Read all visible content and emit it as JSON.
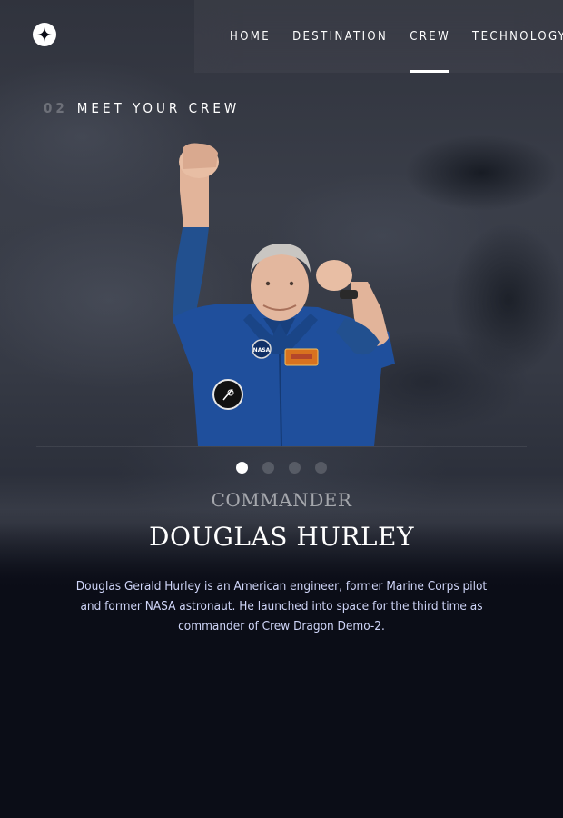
{
  "nav": {
    "items": [
      {
        "label": "HOME"
      },
      {
        "label": "DESTINATION"
      },
      {
        "label": "CREW",
        "active": true
      },
      {
        "label": "TECHNOLOGY"
      }
    ]
  },
  "section": {
    "number": "02",
    "title": "MEET YOUR CREW"
  },
  "crew": {
    "role": "COMMANDER",
    "name": "DOUGLAS HURLEY",
    "bio": "Douglas Gerald Hurley is an American engineer, former Marine Corps pilot and former NASA astronaut. He launched into space for the third time as commander of Crew Dragon Demo-2.",
    "patch_text": "NASA",
    "slides_total": 4,
    "slide_active": 1
  },
  "colors": {
    "background": "#0b0d17",
    "accent_text": "#d0d6f9",
    "suit": "#1f4f9c"
  },
  "icons": {
    "logo": "star-logo-icon"
  }
}
